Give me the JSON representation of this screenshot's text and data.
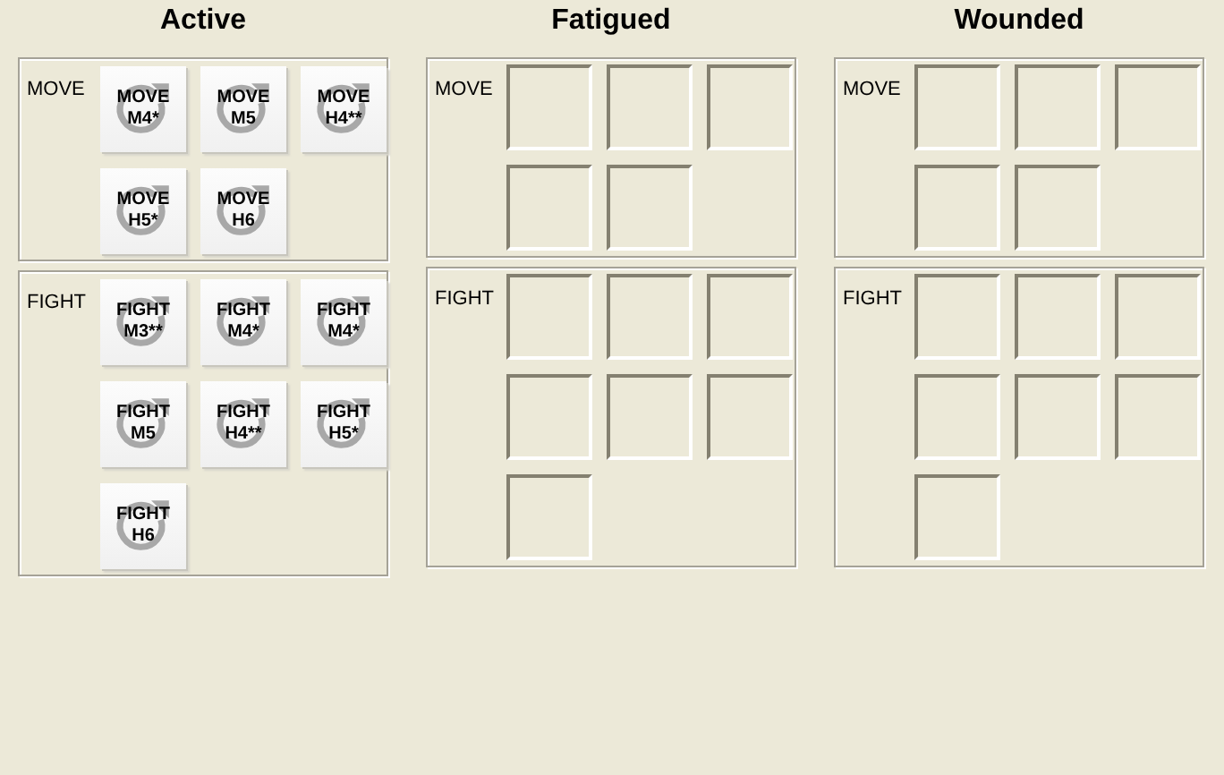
{
  "columns": [
    {
      "title": "Active",
      "groups": [
        {
          "label": "MOVE",
          "slots": [
            {
              "kind": "card",
              "line1": "MOVE",
              "line2": "M4*"
            },
            {
              "kind": "card",
              "line1": "MOVE",
              "line2": "M5"
            },
            {
              "kind": "card",
              "line1": "MOVE",
              "line2": "H4**"
            },
            {
              "kind": "card",
              "line1": "MOVE",
              "line2": "H5*"
            },
            {
              "kind": "card",
              "line1": "MOVE",
              "line2": "H6"
            }
          ]
        },
        {
          "label": "FIGHT",
          "slots": [
            {
              "kind": "card",
              "line1": "FIGHT",
              "line2": "M3**"
            },
            {
              "kind": "card",
              "line1": "FIGHT",
              "line2": "M4*"
            },
            {
              "kind": "card",
              "line1": "FIGHT",
              "line2": "M4*"
            },
            {
              "kind": "card",
              "line1": "FIGHT",
              "line2": "M5"
            },
            {
              "kind": "card",
              "line1": "FIGHT",
              "line2": "H4**"
            },
            {
              "kind": "card",
              "line1": "FIGHT",
              "line2": "H5*"
            },
            {
              "kind": "card",
              "line1": "FIGHT",
              "line2": "H6"
            }
          ]
        }
      ]
    },
    {
      "title": "Fatigued",
      "groups": [
        {
          "label": "MOVE",
          "slots": [
            {
              "kind": "empty"
            },
            {
              "kind": "empty"
            },
            {
              "kind": "empty"
            },
            {
              "kind": "empty"
            },
            {
              "kind": "empty"
            }
          ]
        },
        {
          "label": "FIGHT",
          "slots": [
            {
              "kind": "empty"
            },
            {
              "kind": "empty"
            },
            {
              "kind": "empty"
            },
            {
              "kind": "empty"
            },
            {
              "kind": "empty"
            },
            {
              "kind": "empty"
            },
            {
              "kind": "empty"
            }
          ]
        }
      ]
    },
    {
      "title": "Wounded",
      "groups": [
        {
          "label": "MOVE",
          "slots": [
            {
              "kind": "empty"
            },
            {
              "kind": "empty"
            },
            {
              "kind": "empty"
            },
            {
              "kind": "empty"
            },
            {
              "kind": "empty"
            }
          ]
        },
        {
          "label": "FIGHT",
          "slots": [
            {
              "kind": "empty"
            },
            {
              "kind": "empty"
            },
            {
              "kind": "empty"
            },
            {
              "kind": "empty"
            },
            {
              "kind": "empty"
            },
            {
              "kind": "empty"
            },
            {
              "kind": "empty"
            }
          ]
        }
      ]
    }
  ]
}
